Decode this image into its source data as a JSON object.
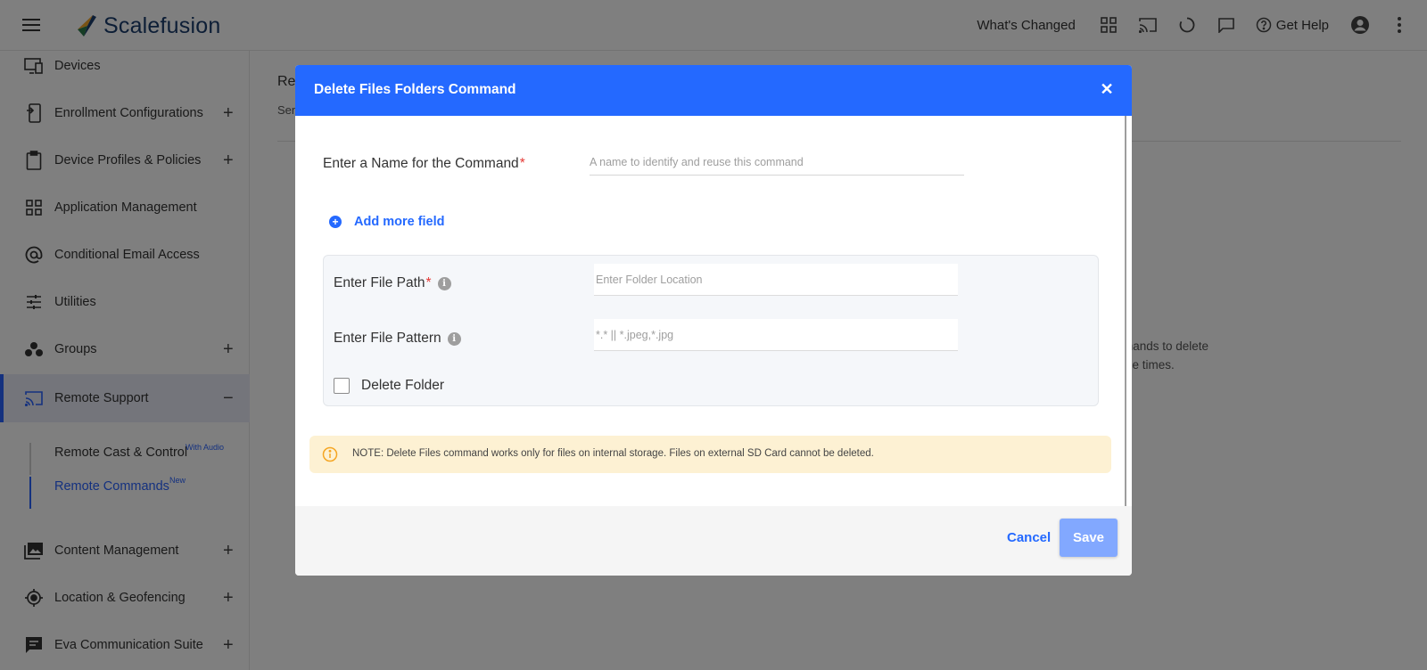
{
  "app": {
    "brand": "Scalefusion"
  },
  "header": {
    "whats_changed": "What's Changed",
    "get_help": "Get Help"
  },
  "sidebar": {
    "items": [
      {
        "label": "Devices",
        "icon": "devices-icon",
        "expandable": false
      },
      {
        "label": "Enrollment Configurations",
        "icon": "enrollment-icon",
        "expandable": true
      },
      {
        "label": "Device Profiles & Policies",
        "icon": "clipboard-icon",
        "expandable": true
      },
      {
        "label": "Application Management",
        "icon": "grid-icon",
        "expandable": false
      },
      {
        "label": "Conditional Email Access",
        "icon": "at-icon",
        "expandable": false
      },
      {
        "label": "Utilities",
        "icon": "sliders-icon",
        "expandable": false
      },
      {
        "label": "Groups",
        "icon": "groups-icon",
        "expandable": true
      },
      {
        "label": "Remote Support",
        "icon": "cast-icon",
        "expandable": true,
        "expanded": true
      },
      {
        "label": "Content Management",
        "icon": "images-icon",
        "expandable": true
      },
      {
        "label": "Location & Geofencing",
        "icon": "location-icon",
        "expandable": true
      },
      {
        "label": "Eva Communication Suite",
        "icon": "chat-icon",
        "expandable": true
      }
    ],
    "remote_support_sub": [
      {
        "label": "Remote Cast & Control",
        "badge": "With Audio"
      },
      {
        "label": "Remote Commands",
        "badge": "New",
        "active": true
      }
    ],
    "plus_sign": "+",
    "minus_sign": "−"
  },
  "page": {
    "title_fragment": "Re",
    "sub_fragment": "Sen",
    "desc_line1": "mands to delete",
    "desc_line2": "ple times."
  },
  "modal": {
    "title": "Delete Files Folders Command",
    "close_glyph": "✕",
    "name_label": "Enter a Name for the Command",
    "required_mark": "*",
    "name_placeholder": "A name to identify and reuse this command",
    "add_more_label": "Add more field",
    "file_path_label": "Enter File Path",
    "file_path_placeholder": "Enter Folder Location",
    "file_pattern_label": "Enter File Pattern",
    "file_pattern_placeholder": "*.* || *.jpeg,*.jpg",
    "delete_folder_label": "Delete Folder",
    "note": "NOTE: Delete Files command works only for files on internal storage. Files on external SD Card cannot be deleted.",
    "cancel_label": "Cancel",
    "save_label": "Save",
    "info_glyph": "i"
  },
  "colors": {
    "primary": "#2469ff",
    "save_disabled": "#82a8ff",
    "note_bg": "#fdf1d3",
    "note_icon": "#f5a623",
    "required": "#e53935"
  }
}
